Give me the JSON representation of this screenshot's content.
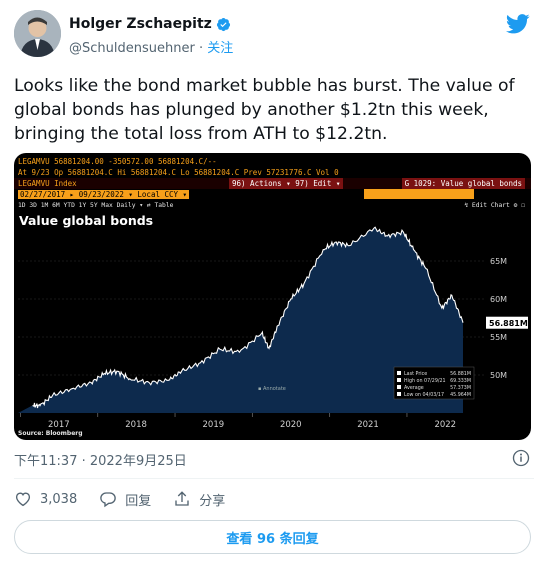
{
  "author": {
    "display_name": "Holger Zschaepitz",
    "handle": "@Schuldensuehner",
    "follow_label": "关注"
  },
  "tweet": {
    "text": "Looks like the bond market bubble has burst. The value of global bonds has plunged by another $1.2tn this week, bringing the total loss from ATH to $12.2tn.",
    "timestamp": "下午11:37 · 2022年9月25日"
  },
  "actions": {
    "like_count": "3,038",
    "reply_label": "回复",
    "share_label": "分享"
  },
  "replies_button_label": "查看 96 条回复",
  "terminal": {
    "row1": "LEGAMVU   56881204.00  -350572.00    56881204.C/--",
    "row2": " At 9/23       Op 56881204.C  Hi 56881204.C  Lo 56881204.C  Prev  57231776.C  Vol 0",
    "row3_left": "LEGAMVU Index",
    "row3_mid": "96) Actions ▾   97) Edit ▾",
    "row3_right": "G 1029: Value global bonds",
    "row4": "02/27/2017 ▸ 09/23/2022 ▾    Local CCY ▾",
    "row5": " 1D  3D  1M  6M  YTD  1Y  5Y  Max   Daily ▾     ⇄     Table",
    "row5_right": "↯ Edit Chart ⚙ ☐",
    "source": "Source: Bloomberg",
    "chart_title": "Value global bonds",
    "legend": {
      "last_price": "Last Price",
      "last_price_val": "56.881M",
      "high": "High on 07/29/21",
      "high_val": "69.333M",
      "average": "Average",
      "average_val": "57.373M",
      "low": "Low on 04/03/17",
      "low_val": "45.964M"
    },
    "annotate": "Annotate",
    "accent_orange": "#f7a01a",
    "accent_red": "#ff4040",
    "area_fill": "#0d2a4d"
  },
  "chart_data": {
    "type": "area",
    "title": "Value global bonds",
    "xlabel": "",
    "ylabel": "",
    "x_ticks": [
      "2017",
      "2018",
      "2019",
      "2020",
      "2021",
      "2022"
    ],
    "y_ticks": [
      "50M",
      "55M",
      "60M",
      "65M"
    ],
    "ylim": [
      45,
      70
    ],
    "last_value_label": "56.881M",
    "series": [
      {
        "values": [
          {
            "x": "2017-02-27",
            "y": 46.0
          },
          {
            "x": "2017-04-03",
            "y": 45.96
          },
          {
            "x": "2017-06-01",
            "y": 47.3
          },
          {
            "x": "2017-09-01",
            "y": 48.2
          },
          {
            "x": "2017-12-01",
            "y": 49.0
          },
          {
            "x": "2018-02-01",
            "y": 50.2
          },
          {
            "x": "2018-04-01",
            "y": 50.5
          },
          {
            "x": "2018-06-01",
            "y": 49.5
          },
          {
            "x": "2018-09-01",
            "y": 49.0
          },
          {
            "x": "2018-12-01",
            "y": 49.3
          },
          {
            "x": "2019-02-01",
            "y": 50.5
          },
          {
            "x": "2019-05-01",
            "y": 51.6
          },
          {
            "x": "2019-08-01",
            "y": 53.4
          },
          {
            "x": "2019-11-01",
            "y": 53.0
          },
          {
            "x": "2020-02-15",
            "y": 55.5
          },
          {
            "x": "2020-03-20",
            "y": 53.5
          },
          {
            "x": "2020-05-01",
            "y": 56.5
          },
          {
            "x": "2020-07-01",
            "y": 60.0
          },
          {
            "x": "2020-09-01",
            "y": 62.0
          },
          {
            "x": "2020-12-01",
            "y": 66.5
          },
          {
            "x": "2021-02-01",
            "y": 67.5
          },
          {
            "x": "2021-04-01",
            "y": 67.0
          },
          {
            "x": "2021-07-29",
            "y": 69.33
          },
          {
            "x": "2021-10-01",
            "y": 68.3
          },
          {
            "x": "2021-12-15",
            "y": 68.8
          },
          {
            "x": "2022-02-01",
            "y": 66.5
          },
          {
            "x": "2022-04-01",
            "y": 64.0
          },
          {
            "x": "2022-06-15",
            "y": 58.8
          },
          {
            "x": "2022-08-01",
            "y": 60.5
          },
          {
            "x": "2022-09-23",
            "y": 56.88
          }
        ]
      }
    ]
  }
}
